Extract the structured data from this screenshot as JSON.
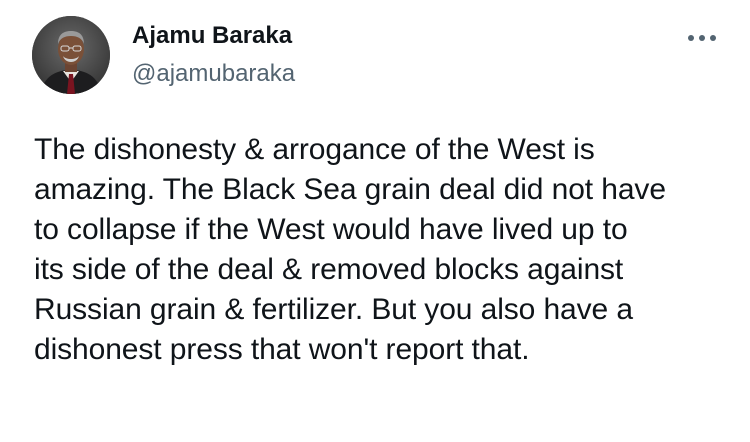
{
  "author": {
    "display_name": "Ajamu Baraka",
    "handle": "@ajamubaraka"
  },
  "menu_icon": "more-horizontal-icon",
  "tweet": {
    "lines": [
      "The dishonesty & arrogance of the West is",
      "amazing. The Black Sea grain deal did not have",
      "to collapse if the West would have lived up to",
      "its side of the deal & removed blocks against",
      "Russian grain & fertilizer. But you also have a",
      "dishonest press that won't report that."
    ]
  },
  "colors": {
    "text": "#0f1419",
    "secondary": "#536471"
  }
}
